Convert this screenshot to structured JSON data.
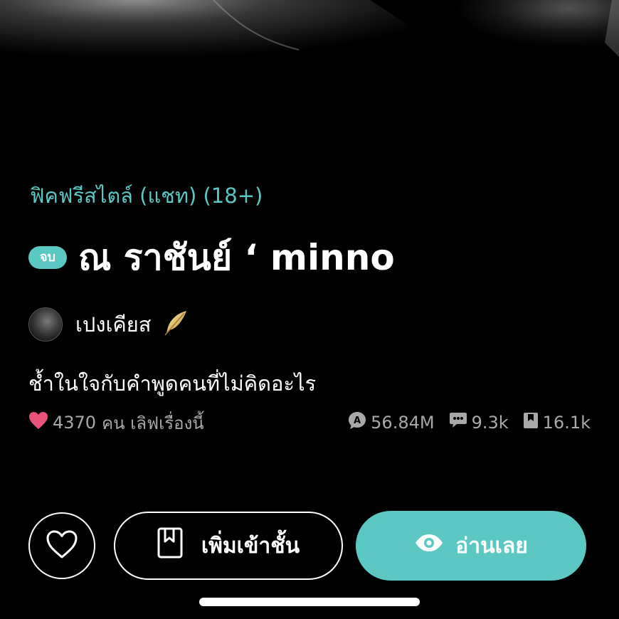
{
  "story": {
    "category": "ฟิคฟรีสไตล์ (แชท) (18+)",
    "status_badge": "จบ",
    "title": "ณ ราชันย์ ‘ minno",
    "author": "เปงเคียส",
    "tagline": "ช้ำในใจกับคำพูดคนที่ไม่คิดอะไร"
  },
  "stats": {
    "love_count": "4370",
    "love_text": "คน เลิฟเรื่องนี้",
    "views": "56.84M",
    "comments": "9.3k",
    "bookmarks": "16.1k"
  },
  "actions": {
    "add_library_label": "เพิ่มเข้าชั้น",
    "read_now_label": "อ่านเลย"
  },
  "icons": {
    "love": "heart-icon",
    "views": "views-badge-icon",
    "comments": "comment-icon",
    "bookmarks": "bookmark-icon",
    "favorite": "heart-outline-icon",
    "library": "book-icon",
    "read": "eye-icon",
    "author_badge": "feather-icon"
  },
  "colors": {
    "accent": "#5cc8c4",
    "heart": "#e9537a",
    "background": "#000000",
    "muted_text": "#a9a9a9"
  }
}
